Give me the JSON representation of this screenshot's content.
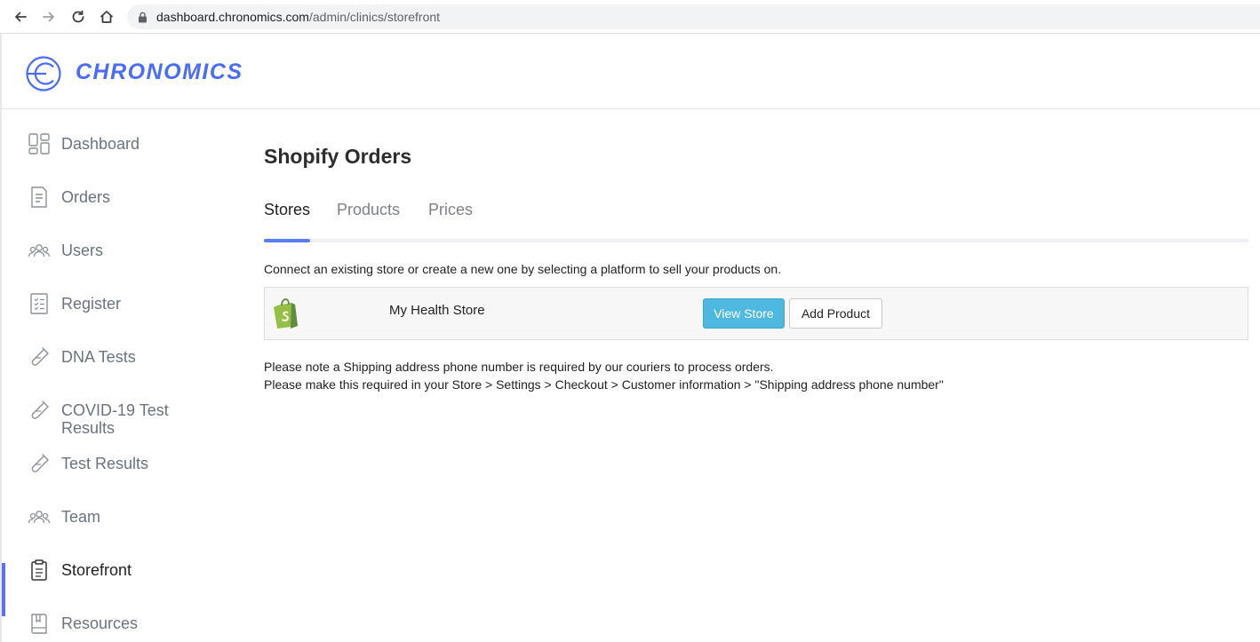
{
  "browser": {
    "url_host": "dashboard.chronomics.com",
    "url_path": "/admin/clinics/storefront",
    "icons": [
      "back-arrow-icon",
      "forward-arrow-icon",
      "reload-icon",
      "home-icon",
      "lock-icon"
    ]
  },
  "brand": {
    "name": "CHRONOMICS",
    "color": "#4a6cf7"
  },
  "sidebar": {
    "items": [
      {
        "label": "Dashboard",
        "icon": "dashboard-grid-icon"
      },
      {
        "label": "Orders",
        "icon": "document-icon"
      },
      {
        "label": "Users",
        "icon": "users-group-icon"
      },
      {
        "label": "Register",
        "icon": "checklist-icon"
      },
      {
        "label": "DNA Tests",
        "icon": "test-tube-icon"
      },
      {
        "label": "COVID-19 Test",
        "label2": "Results",
        "icon": "test-tube-icon"
      },
      {
        "label": "Test Results",
        "icon": "test-tube-icon"
      },
      {
        "label": "Team",
        "icon": "team-group-icon"
      },
      {
        "label": "Storefront",
        "icon": "clipboard-icon",
        "active": true
      },
      {
        "label": "Resources",
        "icon": "book-icon"
      }
    ],
    "active_color": "#5b6ef5"
  },
  "main": {
    "title": "Shopify Orders",
    "tabs": [
      {
        "label": "Stores",
        "active": true
      },
      {
        "label": "Products"
      },
      {
        "label": "Prices"
      }
    ],
    "intro": "Connect an existing store or create a new one by selecting a platform to sell your products on.",
    "store": {
      "platform_icon": "shopify-bag-icon",
      "name": "My Health Store",
      "view_label": "View Store",
      "add_label": "Add Product"
    },
    "note_line1": "Please note a Shipping address phone number is required by our couriers to process orders.",
    "note_line2": "Please make this required in your Store > Settings > Checkout > Customer information > \"Shipping address phone number\""
  }
}
